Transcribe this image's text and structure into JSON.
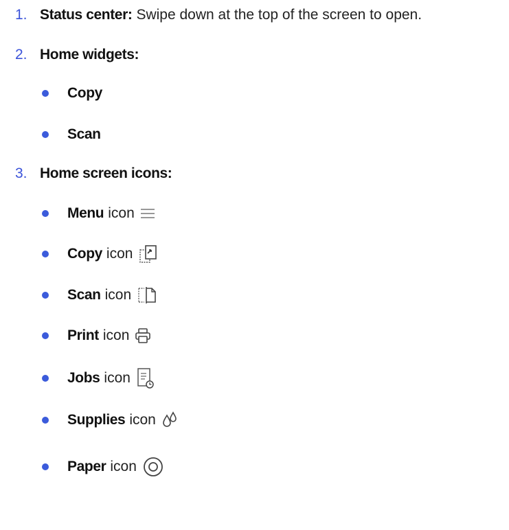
{
  "items": [
    {
      "number": "1.",
      "label": "Status center:",
      "description": "Swipe down at the top of the screen to open."
    },
    {
      "number": "2.",
      "label": "Home widgets:",
      "children": [
        {
          "label": "Copy"
        },
        {
          "label": "Scan"
        }
      ]
    },
    {
      "number": "3.",
      "label": "Home screen icons:",
      "children": [
        {
          "label": "Menu",
          "suffix": "icon",
          "icon": "menu-icon"
        },
        {
          "label": "Copy",
          "suffix": "icon",
          "icon": "copy-icon"
        },
        {
          "label": "Scan",
          "suffix": "icon",
          "icon": "scan-icon"
        },
        {
          "label": "Print",
          "suffix": "icon",
          "icon": "print-icon"
        },
        {
          "label": "Jobs",
          "suffix": "icon",
          "icon": "jobs-icon"
        },
        {
          "label": "Supplies",
          "suffix": "icon",
          "icon": "supplies-icon"
        },
        {
          "label": "Paper",
          "suffix": "icon",
          "icon": "paper-icon"
        }
      ]
    }
  ],
  "colors": {
    "number": "#3b53d9",
    "bullet": "#3b5bdb",
    "text": "#111111"
  }
}
